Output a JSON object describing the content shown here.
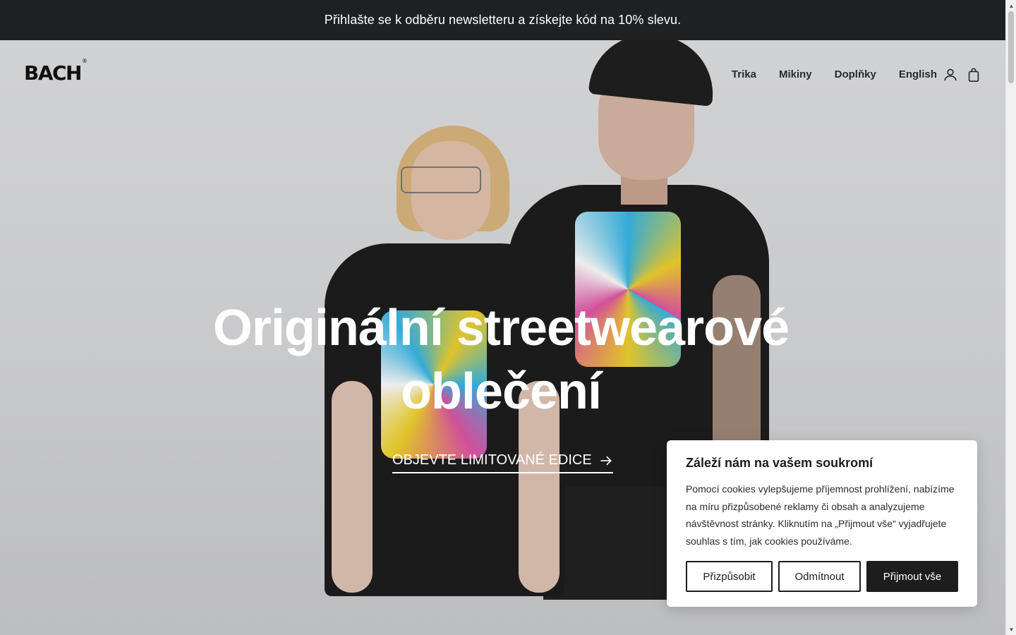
{
  "announcement": "Přihlašte se k odběru newsletteru a získejte kód na 10% slevu.",
  "brand": {
    "name": "BACH",
    "mark": "®"
  },
  "nav": {
    "items": [
      "Trika",
      "Mikiny",
      "Doplňky",
      "English"
    ]
  },
  "icons": {
    "account": "user-icon",
    "cart": "shopping-bag-icon",
    "cta_arrow": "arrow-right-icon"
  },
  "hero": {
    "title_line1": "Originální streetwearové",
    "title_line2": "oblečení",
    "cta": "OBJEVTE LIMITOVANÉ EDICE"
  },
  "cookie": {
    "title": "Záleží nám na vašem soukromí",
    "text": "Pomocí cookies vylepšujeme příjemnost prohlížení, nabízíme na míru přizpůsobené reklamy či obsah a analyzujeme návštěvnost stránky. Kliknutím na „Přijmout vše“ vyjadřujete souhlas s tím, jak cookies používáme.",
    "customize": "Přizpůsobit",
    "reject": "Odmítnout",
    "accept": "Přijmout vše"
  },
  "colors": {
    "announce_bg": "#1f2022",
    "primary_dark": "#1d1d1d",
    "hero_text": "#ffffff"
  }
}
